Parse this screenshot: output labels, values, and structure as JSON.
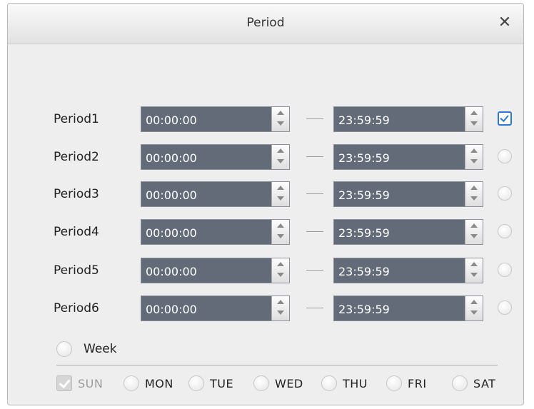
{
  "dialog": {
    "title": "Period",
    "close_glyph": "✕",
    "close_icon": "close-icon"
  },
  "periods": [
    {
      "label": "Period1",
      "start": "00:00:00",
      "end": "23:59:59",
      "enabled": true
    },
    {
      "label": "Period2",
      "start": "00:00:00",
      "end": "23:59:59",
      "enabled": false
    },
    {
      "label": "Period3",
      "start": "00:00:00",
      "end": "23:59:59",
      "enabled": false
    },
    {
      "label": "Period4",
      "start": "00:00:00",
      "end": "23:59:59",
      "enabled": false
    },
    {
      "label": "Period5",
      "start": "00:00:00",
      "end": "23:59:59",
      "enabled": false
    },
    {
      "label": "Period6",
      "start": "00:00:00",
      "end": "23:59:59",
      "enabled": false
    }
  ],
  "week": {
    "label": "Week",
    "selected": false
  },
  "days": [
    {
      "label": "SUN",
      "checked": true,
      "disabled": true
    },
    {
      "label": "MON",
      "checked": false,
      "disabled": false
    },
    {
      "label": "TUE",
      "checked": false,
      "disabled": false
    },
    {
      "label": "WED",
      "checked": false,
      "disabled": false
    },
    {
      "label": "THU",
      "checked": false,
      "disabled": false
    },
    {
      "label": "FRI",
      "checked": false,
      "disabled": false
    },
    {
      "label": "SAT",
      "checked": false,
      "disabled": false
    }
  ],
  "colors": {
    "input_bg": "#636b78",
    "accent": "#2f79d1",
    "dialog_bg": "#eeeeee"
  }
}
